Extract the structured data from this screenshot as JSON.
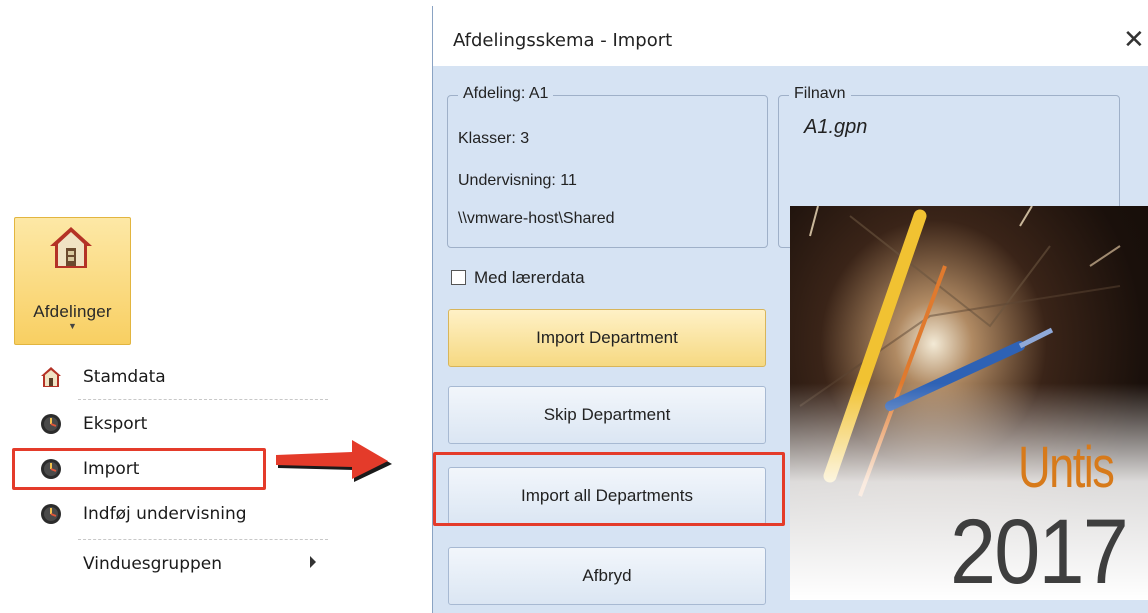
{
  "ribbon": {
    "label": "Afdelinger"
  },
  "menu": {
    "items": [
      {
        "label": "Stamdata",
        "icon": "house-icon"
      },
      {
        "label": "Eksport",
        "icon": "clock-icon"
      },
      {
        "label": "Import",
        "icon": "clock-icon"
      },
      {
        "label": "Indføj undervisning",
        "icon": "clock-icon"
      },
      {
        "label": "Vinduesgruppen",
        "icon": "submenu-arrow-icon"
      }
    ],
    "highlighted": "Import"
  },
  "dialog": {
    "title": "Afdelingsskema - Import",
    "department_group": {
      "legend": "Afdeling: A1",
      "classes": "Klasser: 3",
      "teaching": "Undervisning: 11",
      "path": "\\\\vmware-host\\Shared"
    },
    "filename_group": {
      "legend": "Filnavn",
      "value": "A1.gpn"
    },
    "teacher_data_checkbox": {
      "label": "Med lærerdata",
      "checked": false
    },
    "buttons": {
      "import_department": "Import Department",
      "skip_department": "Skip Department",
      "import_all": "Import all Departments",
      "cancel": "Afbryd"
    },
    "splash": {
      "brand": "Untis",
      "year": "2017"
    }
  },
  "colors": {
    "highlight": "#e43b2a",
    "dialog_bg": "#d6e3f3",
    "ribbon_active": "#f8cf62",
    "brand_orange": "#d77a1a"
  }
}
